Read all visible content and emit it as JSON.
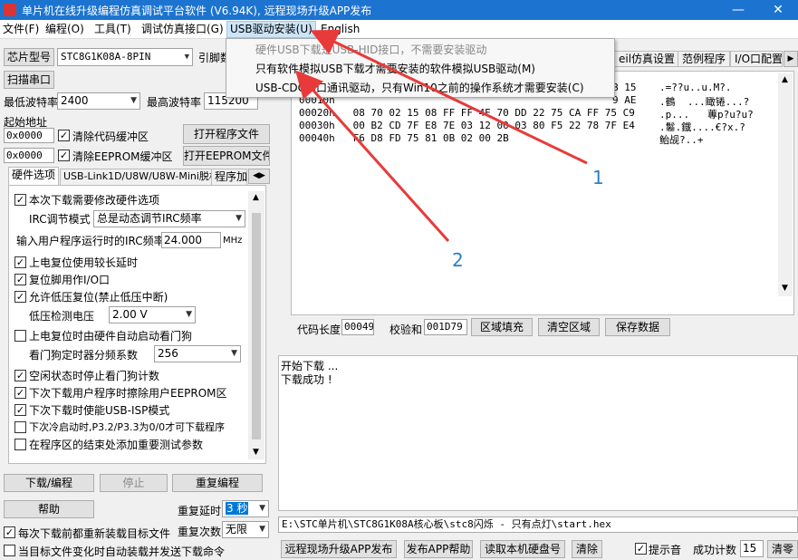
{
  "window": {
    "title": "单片机在线升级编程仿真调试平台软件 (V6.94K), 远程现场升级APP发布",
    "minimize": "—",
    "maximize": "☐",
    "close": "✕"
  },
  "menu": {
    "items": [
      "文件(F)",
      "编程(O)",
      "工具(T)",
      "调试仿真接口(G)",
      "USB驱动安装(U)",
      "English"
    ]
  },
  "dropdown": {
    "items": [
      "硬件USB下载是USB-HID接口，不需要安装驱动",
      "只有软件模拟USB下载才需要安装的软件模拟USB驱动(M)",
      "USB-CDC串口通讯驱动，只有Win10之前的操作系统才需要安装(C)"
    ]
  },
  "left": {
    "chip_label": "芯片型号",
    "chip_value": "STC8G1K08A-8PIN",
    "pin_label": "引脚数",
    "scan_label": "扫描串口",
    "min_baud_label": "最低波特率",
    "min_baud_value": "2400",
    "max_baud_label": "最高波特率",
    "max_baud_value": "115200",
    "start_addr_label": "起始地址",
    "addr1": "0x0000",
    "clear_code_label": "清除代码缓冲区",
    "open_prog_label": "打开程序文件",
    "addr2": "0x0000",
    "clear_eeprom_label": "清除EEPROM缓冲区",
    "open_eeprom_label": "打开EEPROM文件"
  },
  "left_tabs": [
    "硬件选项",
    "USB-Link1D/U8W/U8W-Mini脱机",
    "程序加"
  ],
  "options": {
    "opt1": "本次下载需要修改硬件选项",
    "irc_mode_label": "IRC调节模式",
    "irc_mode_value": "总是动态调节IRC频率",
    "irc_freq_label": "输入用户程序运行时的IRC频率",
    "irc_freq_value": "24.000",
    "irc_freq_unit": "MHz",
    "opt2": "上电复位使用较长延时",
    "opt3": "复位脚用作I/O口",
    "opt4": "允许低压复位(禁止低压中断)",
    "lvd_label": "低压检测电压",
    "lvd_value": "2.00 V",
    "opt5": "上电复位时由硬件自动启动看门狗",
    "wdt_label": "看门狗定时器分频系数",
    "wdt_value": "256",
    "opt6": "空闲状态时停止看门狗计数",
    "opt7": "下次下载用户程序时擦除用户EEPROM区",
    "opt8": "下次下载时使能USB-ISP模式",
    "opt9": "下次冷启动时,P3.2/P3.3为0/0才可下载程序",
    "opt10": "在程序区的结束处添加重要测试参数"
  },
  "bottom_left": {
    "download_label": "下载/编程",
    "stop_label": "停止",
    "reprogram_label": "重复编程",
    "help_label": "帮助",
    "repeat_delay_label": "重复延时",
    "repeat_delay_value": "3 秒",
    "repeat_count_label": "重复次数",
    "repeat_count_value": "无限",
    "reload_label": "每次下载前都重新装载目标文件",
    "auto_send_label": "当目标文件变化时自动装载并发送下载命令"
  },
  "right_tabs": [
    "eil仿真设置",
    "范例程序",
    "I/O口配置"
  ],
  "hex": {
    "lines": [
      "00010h  ",
      "00020h   08 70 02 15 08 FF FF 4E 70 DD 22 75 CA FF 75 C9",
      "00030h   00 B2 CD 7F E8 7E 03 12 00 03 80 F5 22 78 7F E4",
      "00040h   F6 D8 FD 75 81 0B 02 00 2B"
    ],
    "row0_tail": "B 15",
    "row1_tail": "9 AE",
    "ascii": [
      ".=??u..u.M?.",
      ".鶴  ...瞰锩...?",
      ".p...   蓴p?u?u?",
      ".鬈.鐡....€?x.?",
      "鲐觇?..+"
    ]
  },
  "hex_footer": {
    "code_len_label": "代码长度",
    "code_len_value": "00049",
    "checksum_label": "校验和",
    "checksum_value": "001D79",
    "fill_label": "区域填充",
    "clear_label": "清空区域",
    "save_label": "保存数据"
  },
  "log": {
    "lines": [
      "开始下载 ...",
      "下载成功 !"
    ]
  },
  "path": "E:\\STC单片机\\STC8G1K08A核心板\\stc8闪烁 - 只有点灯\\start.hex",
  "bottom_right": {
    "remote_label": "远程现场升级APP发布",
    "publish_help_label": "发布APP帮助",
    "read_disk_label": "读取本机硬盘号",
    "clear_label": "清除",
    "beep_label": "提示音",
    "success_count_label": "成功计数",
    "success_count_value": "15",
    "clear2_label": "清零"
  },
  "annotations": [
    "1",
    "2"
  ],
  "colors": {
    "titlebar": "#1c74d0",
    "arrow": "#e83a3a",
    "annotation": "#2d7fc1"
  }
}
